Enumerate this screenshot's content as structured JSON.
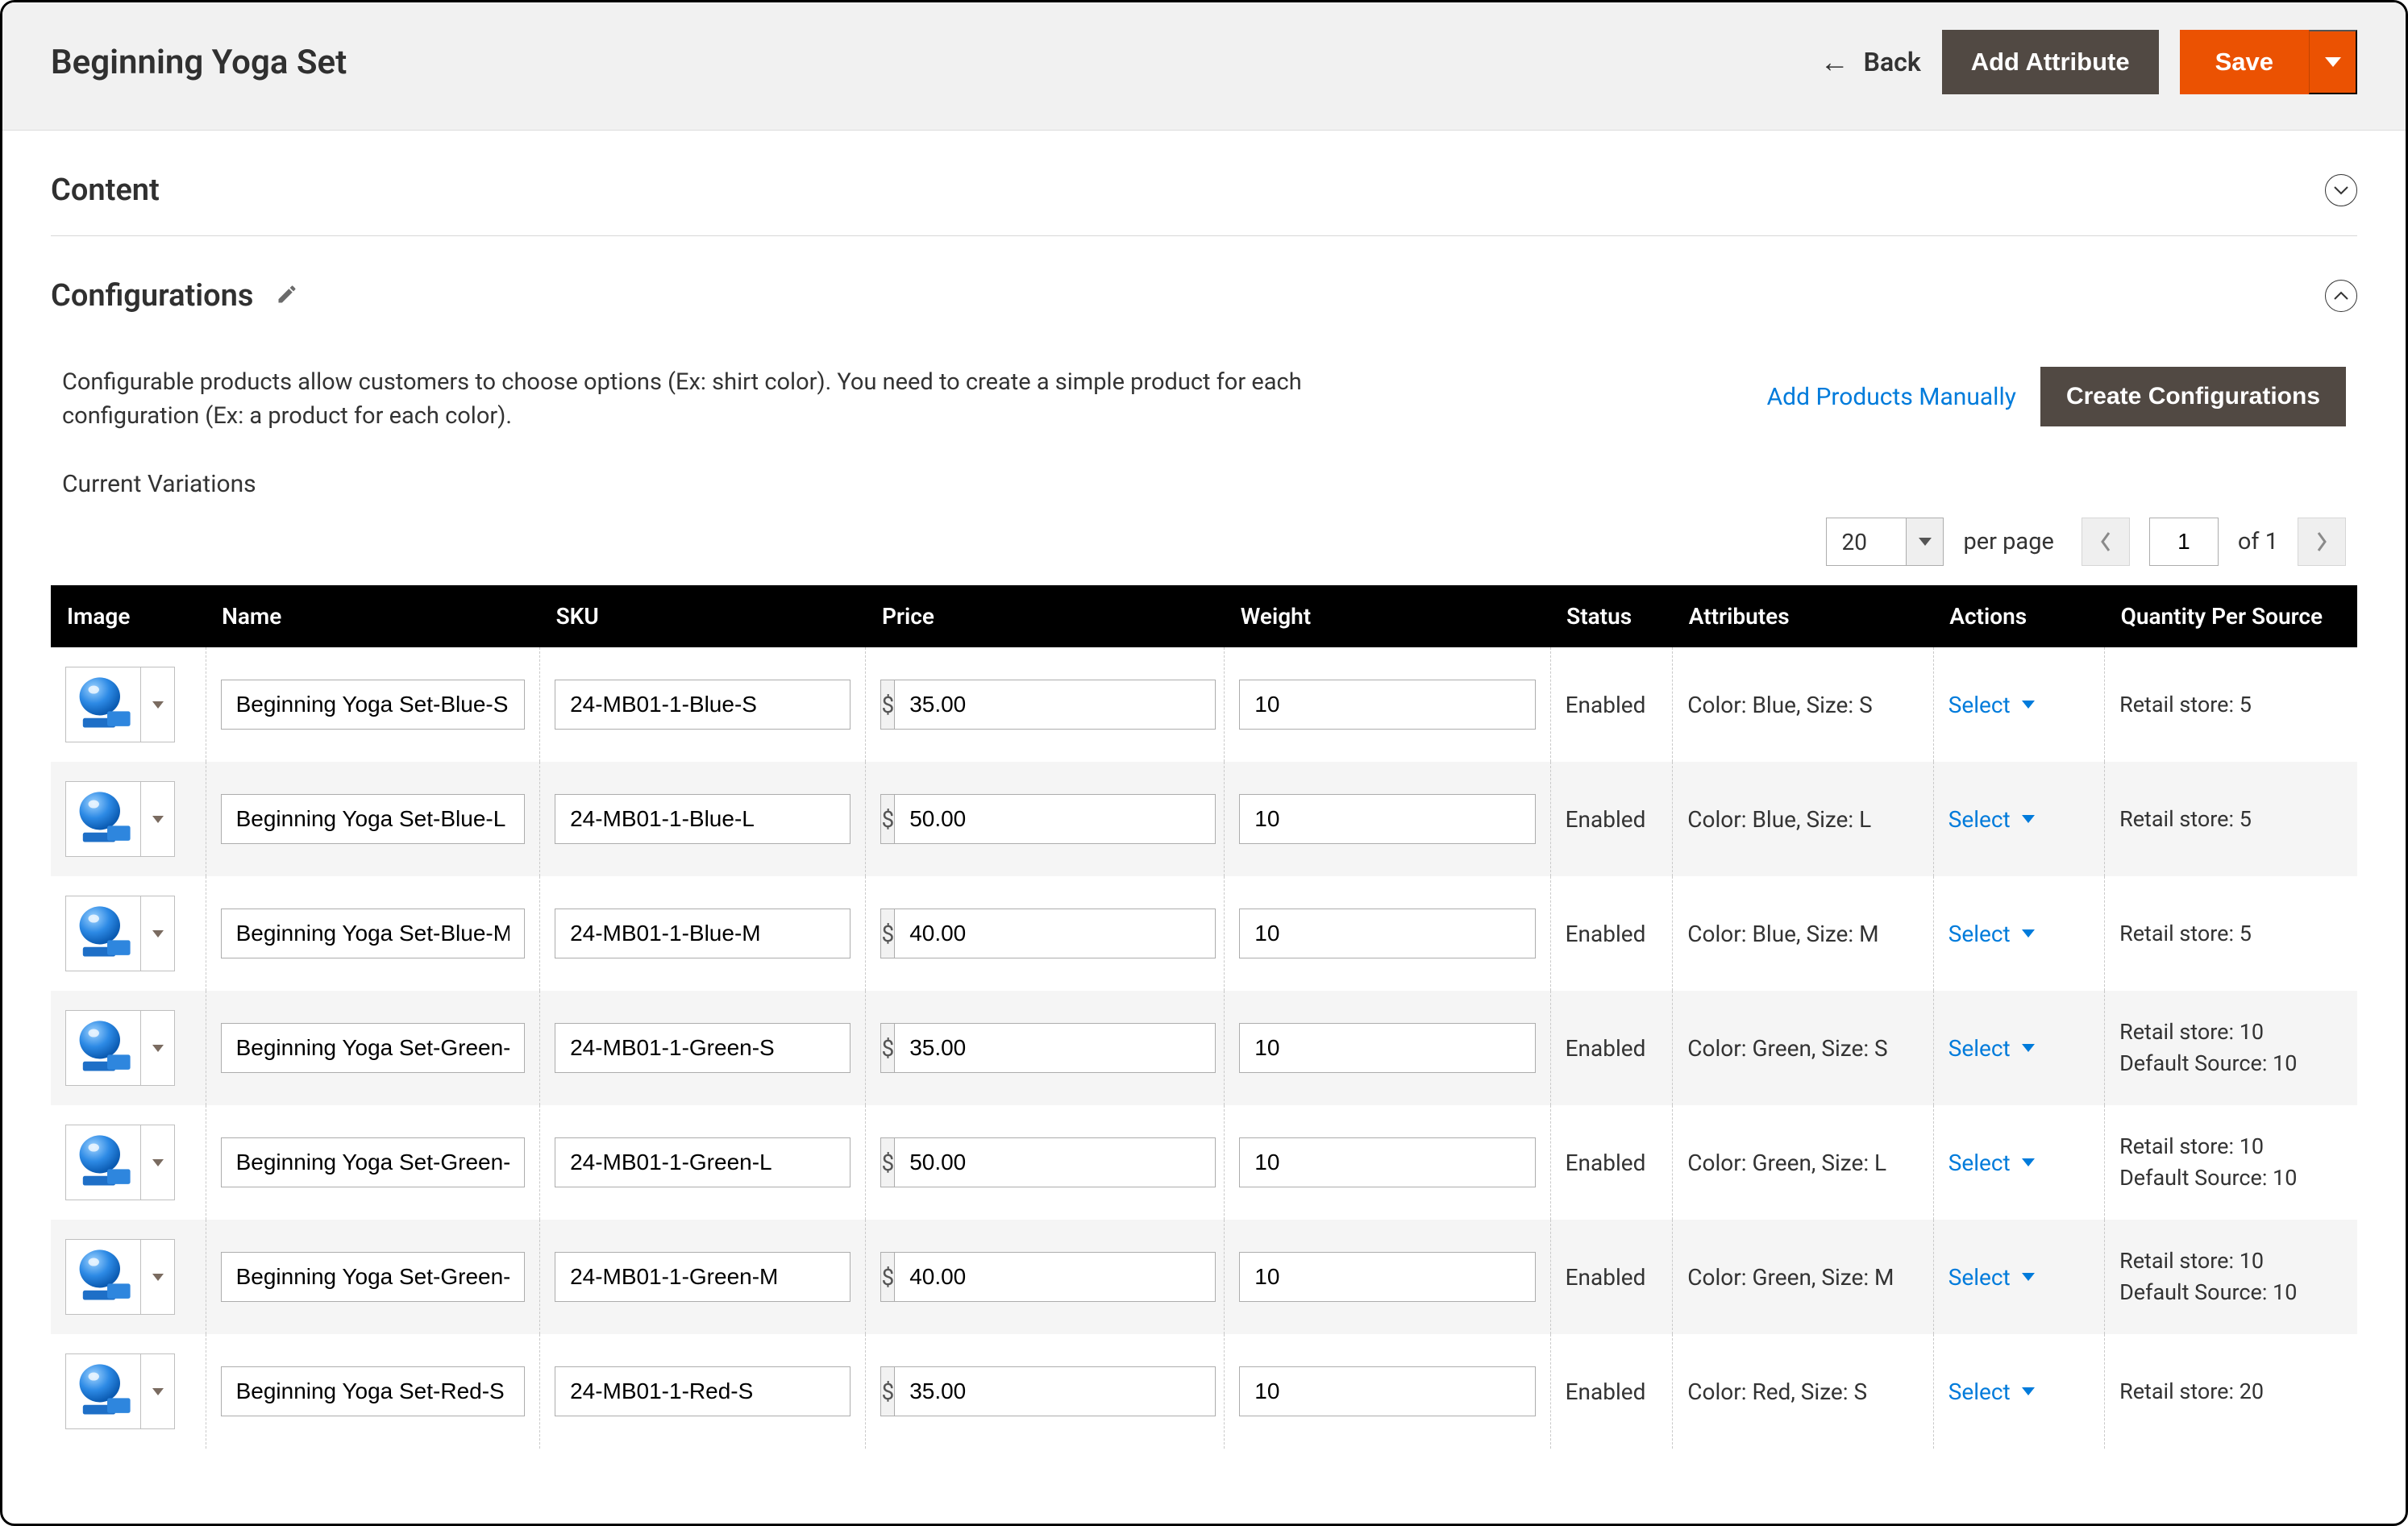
{
  "header": {
    "title": "Beginning Yoga Set",
    "back_label": "Back",
    "add_attribute_label": "Add Attribute",
    "save_label": "Save"
  },
  "sections": {
    "content_title": "Content",
    "configurations_title": "Configurations"
  },
  "configurations": {
    "help_text": "Configurable products allow customers to choose options (Ex: shirt color). You need to create a simple product for each configuration (Ex: a product for each color).",
    "add_manually_label": "Add Products Manually",
    "create_label": "Create Configurations",
    "current_label": "Current Variations"
  },
  "pager": {
    "page_size": "20",
    "per_page_label": "per page",
    "page": "1",
    "of_label": "of 1"
  },
  "table": {
    "headers": {
      "image": "Image",
      "name": "Name",
      "sku": "SKU",
      "price": "Price",
      "weight": "Weight",
      "status": "Status",
      "attributes": "Attributes",
      "actions": "Actions",
      "qty": "Quantity Per Source"
    },
    "currency_symbol": "$",
    "select_label": "Select",
    "rows": [
      {
        "name": "Beginning Yoga Set-Blue-S",
        "sku": "24-MB01-1-Blue-S",
        "price": "35.00",
        "weight": "10",
        "status": "Enabled",
        "attributes": "Color: Blue, Size: S",
        "qty": "Retail store: 5"
      },
      {
        "name": "Beginning Yoga Set-Blue-L",
        "sku": "24-MB01-1-Blue-L",
        "price": "50.00",
        "weight": "10",
        "status": "Enabled",
        "attributes": "Color: Blue, Size: L",
        "qty": "Retail store: 5"
      },
      {
        "name": "Beginning Yoga Set-Blue-M",
        "sku": "24-MB01-1-Blue-M",
        "price": "40.00",
        "weight": "10",
        "status": "Enabled",
        "attributes": "Color: Blue, Size: M",
        "qty": "Retail store: 5"
      },
      {
        "name": "Beginning Yoga Set-Green-S",
        "sku": "24-MB01-1-Green-S",
        "price": "35.00",
        "weight": "10",
        "status": "Enabled",
        "attributes": "Color: Green, Size: S",
        "qty": "Retail store: 10\nDefault Source: 10"
      },
      {
        "name": "Beginning Yoga Set-Green-L",
        "sku": "24-MB01-1-Green-L",
        "price": "50.00",
        "weight": "10",
        "status": "Enabled",
        "attributes": "Color: Green, Size: L",
        "qty": "Retail store: 10\nDefault Source: 10"
      },
      {
        "name": "Beginning Yoga Set-Green-M",
        "sku": "24-MB01-1-Green-M",
        "price": "40.00",
        "weight": "10",
        "status": "Enabled",
        "attributes": "Color: Green, Size: M",
        "qty": "Retail store: 10\nDefault Source: 10"
      },
      {
        "name": "Beginning Yoga Set-Red-S",
        "sku": "24-MB01-1-Red-S",
        "price": "35.00",
        "weight": "10",
        "status": "Enabled",
        "attributes": "Color: Red, Size: S",
        "qty": "Retail store: 20"
      }
    ]
  }
}
